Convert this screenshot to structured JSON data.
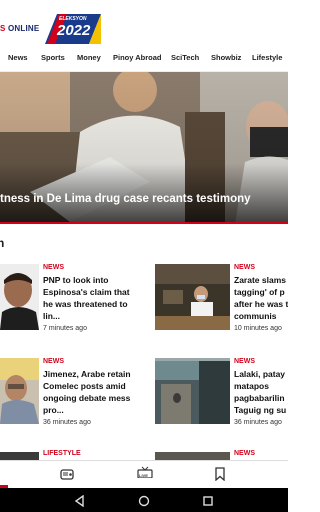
{
  "header": {
    "logo_text_part1": "S",
    "logo_text_part2": " ONLINE",
    "elex_label": "ELEKSYON",
    "elex_year": "2022"
  },
  "nav": {
    "items": [
      "News",
      "Sports",
      "Money",
      "Pinoy Abroad",
      "SciTech",
      "Showbiz",
      "Lifestyle"
    ]
  },
  "hero": {
    "title": "tness in De Lima drug case recants testimony"
  },
  "section": {
    "title": "n"
  },
  "articles": [
    {
      "category": "NEWS",
      "title": "PNP to look into Espinosa's claim that he was threatened to lin...",
      "time": "7 minutes ago"
    },
    {
      "category": "NEWS",
      "title": "Zarate slams tagging' of p after he was to communis",
      "time": "10 minutes ago"
    },
    {
      "category": "NEWS",
      "title": "Jimenez, Arabe retain Comelec posts amid ongoing debate mess pro...",
      "time": "36 minutes ago"
    },
    {
      "category": "NEWS",
      "title": "Lalaki, patay matapos pagbabarilin Taguig ng su",
      "time": "36 minutes ago"
    },
    {
      "category": "LIFESTYLE",
      "title": "",
      "time": ""
    },
    {
      "category": "NEWS",
      "title": "",
      "time": ""
    }
  ],
  "bottom_nav": {
    "live_label": "LIVE"
  },
  "colors": {
    "accent": "#d0021b",
    "brand": "#1a2a6c"
  }
}
